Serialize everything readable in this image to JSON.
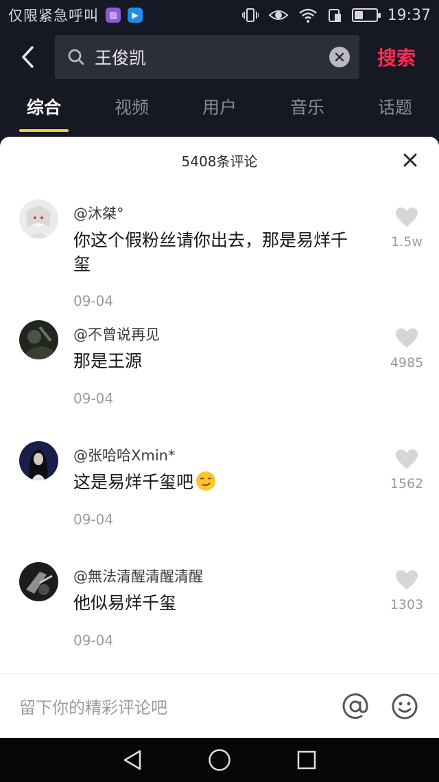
{
  "status_bar": {
    "carrier": "仅限紧急呼叫",
    "time": "19:37",
    "battery_level": 0.4
  },
  "search": {
    "query": "王俊凯",
    "button_label": "搜索"
  },
  "tabs": [
    {
      "label": "综合",
      "active": true
    },
    {
      "label": "视频",
      "active": false
    },
    {
      "label": "用户",
      "active": false
    },
    {
      "label": "音乐",
      "active": false
    },
    {
      "label": "话题",
      "active": false
    }
  ],
  "comments_panel": {
    "title": "5408条评论",
    "comments": [
      {
        "user": "@沐桀°",
        "text": "你这个假粉丝请你出去，那是易烊千玺",
        "date": "09-04",
        "likes": "1.5w"
      },
      {
        "user": "@不曾说再见",
        "text": "那是王源",
        "date": "09-04",
        "likes": "4985"
      },
      {
        "user": "@张哈哈Xmin*",
        "text": "这是易烊千玺吧",
        "date": "09-04",
        "likes": "1562"
      },
      {
        "user": "@無法清醒清醒清醒",
        "text": "他似易烊千玺",
        "date": "09-04",
        "likes": "1303"
      }
    ]
  },
  "input_bar": {
    "placeholder": "留下你的精彩评论吧"
  },
  "colors": {
    "accent": "#fe2c55",
    "tab_underline": "#facd3c",
    "dark_bg": "#161823"
  }
}
